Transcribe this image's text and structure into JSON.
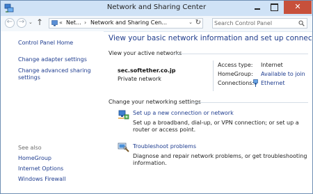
{
  "window": {
    "title": "Network and Sharing Center",
    "close_glyph": "✕"
  },
  "nav": {
    "back_arrow": "←",
    "forward_arrow": "→",
    "recent_arrow": "⌄",
    "up_arrow": "↑"
  },
  "address": {
    "chevron": "«",
    "crumb1": "Net...",
    "separator": "›",
    "crumb2": "Network and Sharing Cen...",
    "dropdown": "⌄",
    "refresh": "↻"
  },
  "search": {
    "placeholder": "Search Control Panel"
  },
  "sidebar": {
    "home": "Control Panel Home",
    "adapter": "Change adapter settings",
    "advanced_line1": "Change advanced sharing",
    "advanced_line2": "settings",
    "see_also": "See also",
    "links": [
      "HomeGroup",
      "Internet Options",
      "Windows Firewall"
    ]
  },
  "main": {
    "title": "View your basic network information and set up connections",
    "active_header": "View your active networks",
    "network_name": "sec.softether.co.jp",
    "network_type": "Private network",
    "access_type_label": "Access type:",
    "access_type_value": "Internet",
    "homegroup_label": "HomeGroup:",
    "homegroup_value": "Available to join",
    "connections_label": "Connections:",
    "connections_value": "Ethernet",
    "settings_header": "Change your networking settings",
    "tasks": [
      {
        "title": "Set up a new connection or network",
        "desc": "Set up a broadband, dial-up, or VPN connection; or set up a router or access point."
      },
      {
        "title": "Troubleshoot problems",
        "desc": "Diagnose and repair network problems, or get troubleshooting information."
      }
    ]
  },
  "colors": {
    "link": "#1e3c8f",
    "titlebar": "#cfe2f6",
    "close_button": "#c7503b"
  },
  "icons": {
    "app": "network-center-icon",
    "address": "control-panel-icon",
    "search": "search-icon",
    "ethernet": "ethernet-icon",
    "new_connection": "network-setup-icon",
    "troubleshoot": "troubleshoot-icon"
  }
}
